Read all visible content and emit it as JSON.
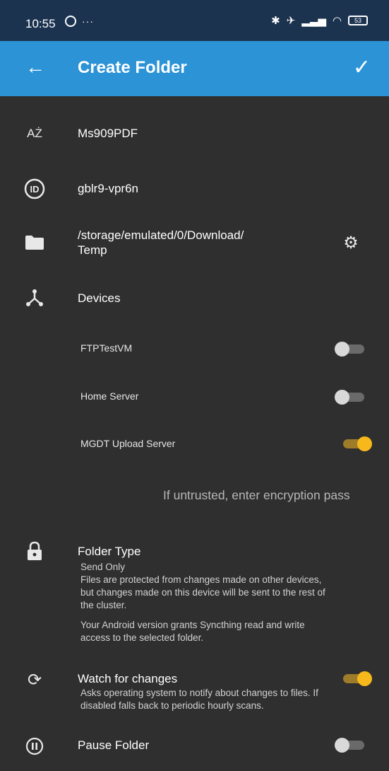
{
  "status_bar": {
    "time": "10:55",
    "notification_dots": "···",
    "battery": "53"
  },
  "app_bar": {
    "title": "Create Folder"
  },
  "folder": {
    "label": "Ms909PDF",
    "id": "gblr9-vpr6n",
    "path_line1": "/storage/emulated/0/Download/",
    "path_line2": "Temp"
  },
  "devices": {
    "heading": "Devices",
    "items": [
      {
        "name": "FTPTestVM",
        "enabled": false
      },
      {
        "name": "Home Server",
        "enabled": false
      },
      {
        "name": "MGDT Upload Server",
        "enabled": true
      }
    ],
    "encryption_hint": "If untrusted, enter encryption pass"
  },
  "folder_type": {
    "heading": "Folder Type",
    "value": "Send Only",
    "description_line1": "Files are protected from changes made on other devices,",
    "description_line2": "but changes made on this device will be sent to the rest of",
    "description_line3": "the cluster.",
    "permission_line1": "Your Android version grants Syncthing read and write",
    "permission_line2": "access to the selected folder."
  },
  "watch_changes": {
    "label": "Watch for changes",
    "description_line1": "Asks operating system to notify about changes to files. If",
    "description_line2": "disabled falls back to periodic hourly scans.",
    "enabled": true
  },
  "pause_folder": {
    "label": "Pause Folder",
    "enabled": false
  },
  "colors": {
    "status_bar": "#1c3350",
    "app_bar": "#2b93d6",
    "background": "#2f2f2f",
    "toggle_on": "#f6b81b"
  }
}
